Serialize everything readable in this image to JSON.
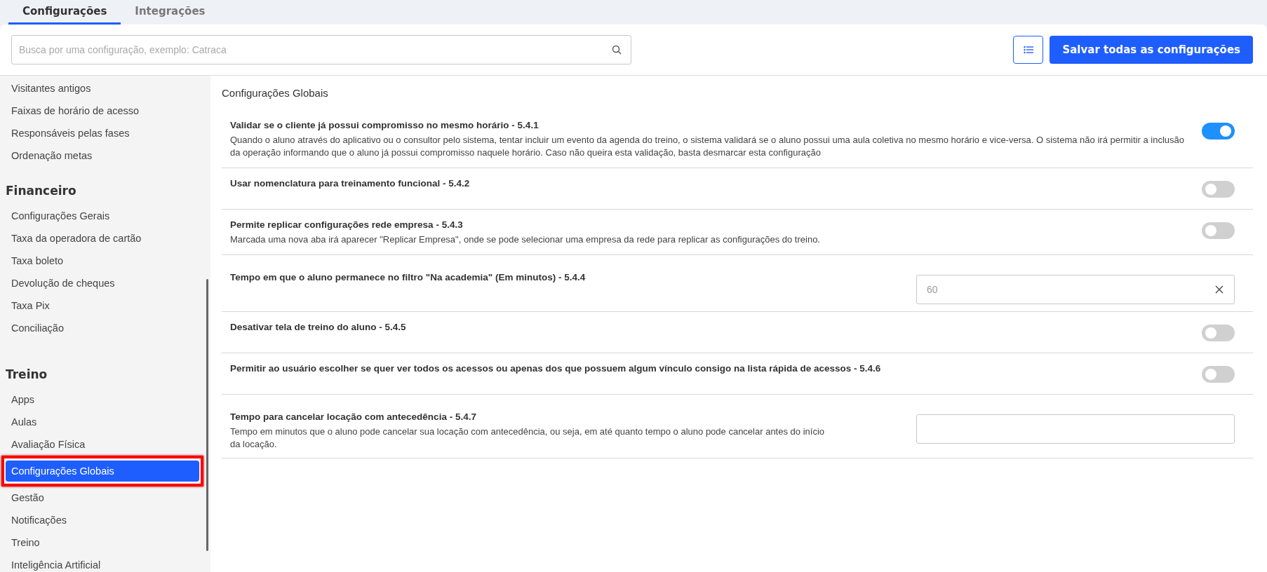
{
  "tabs": [
    {
      "label": "Configurações",
      "selected": true
    },
    {
      "label": "Integrações",
      "selected": false
    }
  ],
  "search": {
    "placeholder": "Busca por uma configuração, exemplo: Catraca"
  },
  "save_button": "Salvar todas as configurações",
  "sidebar": {
    "groups": [
      {
        "items": [
          {
            "label": "Visitantes antigos",
            "selected": false
          },
          {
            "label": "Faixas de horário de acesso",
            "selected": false
          },
          {
            "label": "Responsáveis pelas fases",
            "selected": false
          },
          {
            "label": "Ordenação metas",
            "selected": false
          }
        ]
      },
      {
        "title": "Financeiro",
        "items": [
          {
            "label": "Configurações Gerais",
            "selected": false
          },
          {
            "label": "Taxa da operadora de cartão",
            "selected": false
          },
          {
            "label": "Taxa boleto",
            "selected": false
          },
          {
            "label": "Devolução de cheques",
            "selected": false
          },
          {
            "label": "Taxa Pix",
            "selected": false
          },
          {
            "label": "Conciliação",
            "selected": false
          }
        ]
      },
      {
        "title": "Treino",
        "items": [
          {
            "label": "Apps",
            "selected": false
          },
          {
            "label": "Aulas",
            "selected": false
          },
          {
            "label": "Avaliação Física",
            "selected": false
          },
          {
            "label": "Configurações Globais",
            "selected": true
          },
          {
            "label": "Gestão",
            "selected": false
          },
          {
            "label": "Notificações",
            "selected": false
          },
          {
            "label": "Treino",
            "selected": false
          },
          {
            "label": "Inteligência Artificial",
            "selected": false
          }
        ]
      }
    ]
  },
  "section_title": "Configurações Globais",
  "settings": [
    {
      "kind": "toggle",
      "title": "Validar se o cliente já possui compromisso no mesmo horário - 5.4.1",
      "description": "Quando o aluno através do aplicativo ou o consultor pelo sistema, tentar incluir um evento da agenda do treino, o sistema validará se o aluno possui uma aula coletiva no mesmo horário e vice-versa. O sistema não irá permitir a inclusão da operação informando que o aluno já possui compromisso naquele horário. Caso não queira esta validação, basta desmarcar esta configuração",
      "on": true
    },
    {
      "kind": "toggle",
      "title": "Usar nomenclatura para treinamento funcional - 5.4.2",
      "on": false
    },
    {
      "kind": "toggle",
      "title": "Permite replicar configurações rede empresa - 5.4.3",
      "description": "Marcada uma nova aba irá aparecer \"Replicar Empresa\", onde se pode selecionar uma empresa da rede para replicar as configurações do treino.",
      "on": false
    },
    {
      "kind": "input",
      "title": "Tempo em que o aluno permanece no filtro \"Na academia\" (Em minutos) - 5.4.4",
      "value": "60"
    },
    {
      "kind": "toggle",
      "title": "Desativar tela de treino do aluno - 5.4.5",
      "on": false
    },
    {
      "kind": "toggle",
      "title": "Permitir ao usuário escolher se quer ver todos os acessos ou apenas dos que possuem algum vínculo consigo na lista rápida de acessos - 5.4.6",
      "on": false
    },
    {
      "kind": "input",
      "title": "Tempo para cancelar locação com antecedência - 5.4.7",
      "description": "Tempo em minutos que o aluno pode cancelar sua locação com antecedência, ou seja, em até quanto tempo o aluno pode cancelar antes do início da locação."
    }
  ]
}
